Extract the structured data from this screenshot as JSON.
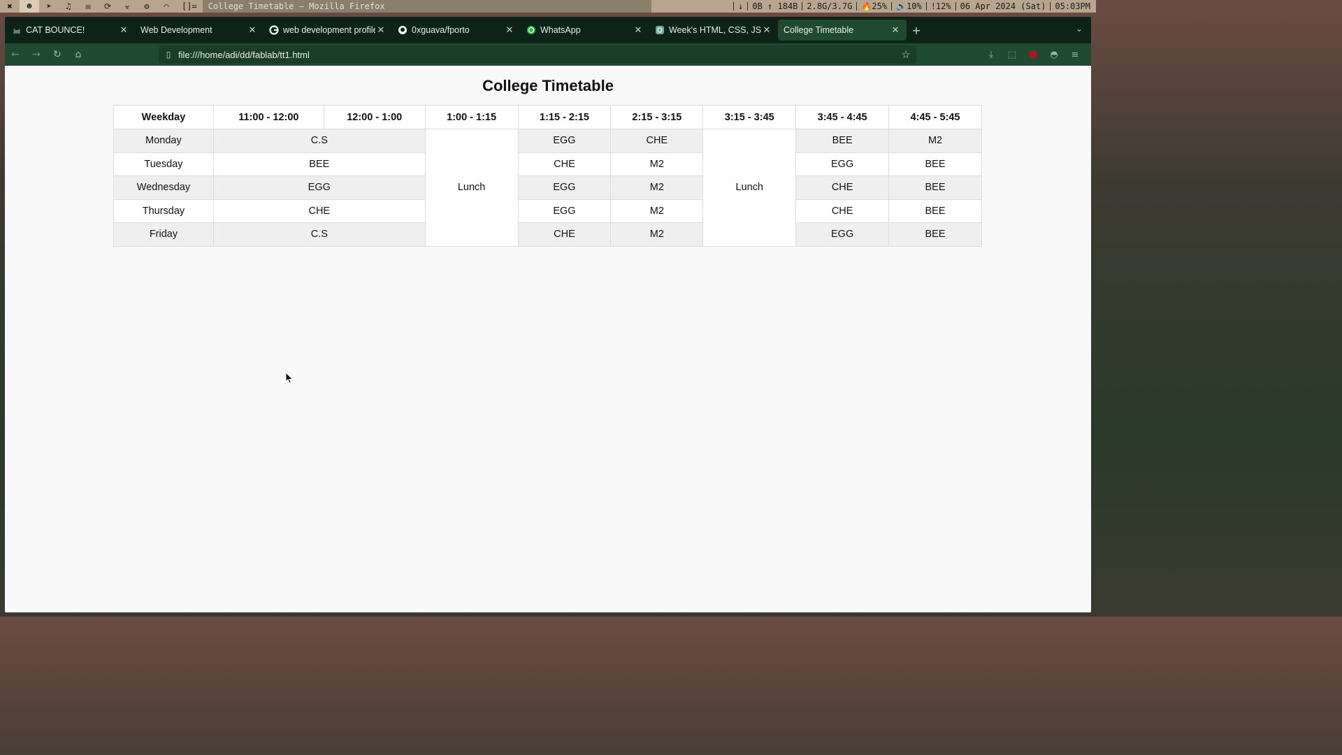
{
  "system_bar": {
    "workspaces": [
      "✖",
      "☻",
      "➤",
      "♫",
      "✉",
      "⟳",
      "☣",
      "⚙",
      "◠"
    ],
    "layout": "[]=",
    "window_title": "College Timetable — Mozilla Firefox",
    "status": [
      "↓",
      "0B ↑ 184B",
      "2.8G/3.7G",
      "🔥25%",
      "🔈10%",
      "!12%",
      "06 Apr 2024 (Sat)",
      "05:03PM"
    ]
  },
  "tabs": [
    {
      "label": "CAT BOUNCE!",
      "icon": "cat-icon",
      "active": false
    },
    {
      "label": "Web Development",
      "icon": "",
      "active": false
    },
    {
      "label": "web development profile",
      "icon": "google-icon",
      "active": false
    },
    {
      "label": "0xguava/fporto",
      "icon": "github-icon",
      "active": false
    },
    {
      "label": "WhatsApp",
      "icon": "whatsapp-icon",
      "active": false
    },
    {
      "label": "Week's HTML, CSS, JS, Git",
      "icon": "chatgpt-icon",
      "active": false
    },
    {
      "label": "College Timetable",
      "icon": "",
      "active": true
    }
  ],
  "url": "file:///home/adi/dd/fablab/tt1.html",
  "page": {
    "title": "College Timetable",
    "headers": [
      "Weekday",
      "11:00 - 12:00",
      "12:00 - 1:00",
      "1:00 - 1:15",
      "1:15 - 2:15",
      "2:15 - 3:15",
      "3:15 - 3:45",
      "3:45 - 4:45",
      "4:45 - 5:45"
    ],
    "lunch_label": "Lunch",
    "rows": [
      {
        "day": "Monday",
        "morning": "C.S",
        "p3": "EGG",
        "p4": "CHE",
        "p5": "BEE",
        "p6": "M2"
      },
      {
        "day": "Tuesday",
        "morning": "BEE",
        "p3": "CHE",
        "p4": "M2",
        "p5": "EGG",
        "p6": "BEE"
      },
      {
        "day": "Wednesday",
        "morning": "EGG",
        "p3": "EGG",
        "p4": "M2",
        "p5": "CHE",
        "p6": "BEE"
      },
      {
        "day": "Thursday",
        "morning": "CHE",
        "p3": "EGG",
        "p4": "M2",
        "p5": "CHE",
        "p6": "BEE"
      },
      {
        "day": "Friday",
        "morning": "C.S",
        "p3": "CHE",
        "p4": "M2",
        "p5": "EGG",
        "p6": "BEE"
      }
    ]
  }
}
